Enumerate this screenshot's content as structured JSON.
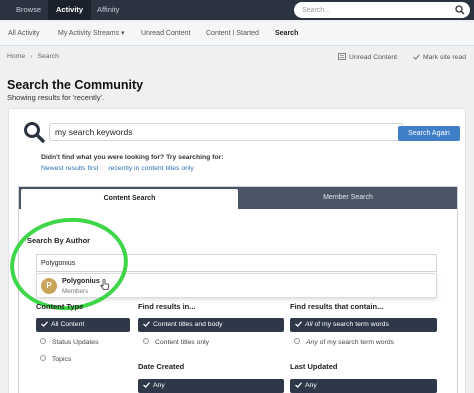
{
  "topnav": {
    "items": [
      {
        "label": "Browse"
      },
      {
        "label": "Activity",
        "active": true
      },
      {
        "label": "Affinity"
      }
    ],
    "search_placeholder": "Search...",
    "bg_color": "#2c3340"
  },
  "subnav": {
    "items": [
      {
        "label": "All Activity"
      },
      {
        "label": "My Activity Streams ▾"
      },
      {
        "label": "Unread Content"
      },
      {
        "label": "Content I Started"
      },
      {
        "label": "Search",
        "active": true
      }
    ]
  },
  "breadcrumb": {
    "items": [
      "Home",
      "Search"
    ],
    "actions": {
      "unread": "Unread Content",
      "mark_read": "Mark site read"
    }
  },
  "page": {
    "title": "Search the Community",
    "subtitle": "Showing results for 'recently'."
  },
  "search": {
    "keywords_value": "my search keywords",
    "button_label": "Search Again",
    "hint": "Didn't find what you were looking for? Try searching for:",
    "links": [
      "Newest results first",
      "recently in content titles only"
    ],
    "accent_color": "#3e7fc8"
  },
  "tabs": [
    {
      "label": "Content Search",
      "active": true
    },
    {
      "label": "Member Search"
    }
  ],
  "author": {
    "label": "Search By Author",
    "input_value": "Polygonius",
    "suggestion": {
      "name": "Polygonius",
      "group": "Members",
      "initial": "P"
    }
  },
  "filters": {
    "content_type": {
      "heading": "Content Type",
      "options": [
        {
          "label": "All Content",
          "selected": true
        },
        {
          "label": "Status Updates"
        },
        {
          "label": "Topics"
        }
      ]
    },
    "find_in": {
      "heading": "Find results in...",
      "options": [
        {
          "label": "Content titles and body",
          "selected": true
        },
        {
          "label": "Content titles only"
        }
      ]
    },
    "contain": {
      "heading": "Find results that contain...",
      "options": [
        {
          "label_em": "All",
          "label_rest": " of my search term words",
          "selected": true
        },
        {
          "label_em": "Any",
          "label_rest": " of my search term words"
        }
      ]
    },
    "date_created": {
      "heading": "Date Created",
      "options": [
        {
          "label": "Any",
          "selected": true
        }
      ]
    },
    "last_updated": {
      "heading": "Last Updated",
      "options": [
        {
          "label": "Any",
          "selected": true
        }
      ]
    }
  },
  "highlight_color": "#3fd64a"
}
